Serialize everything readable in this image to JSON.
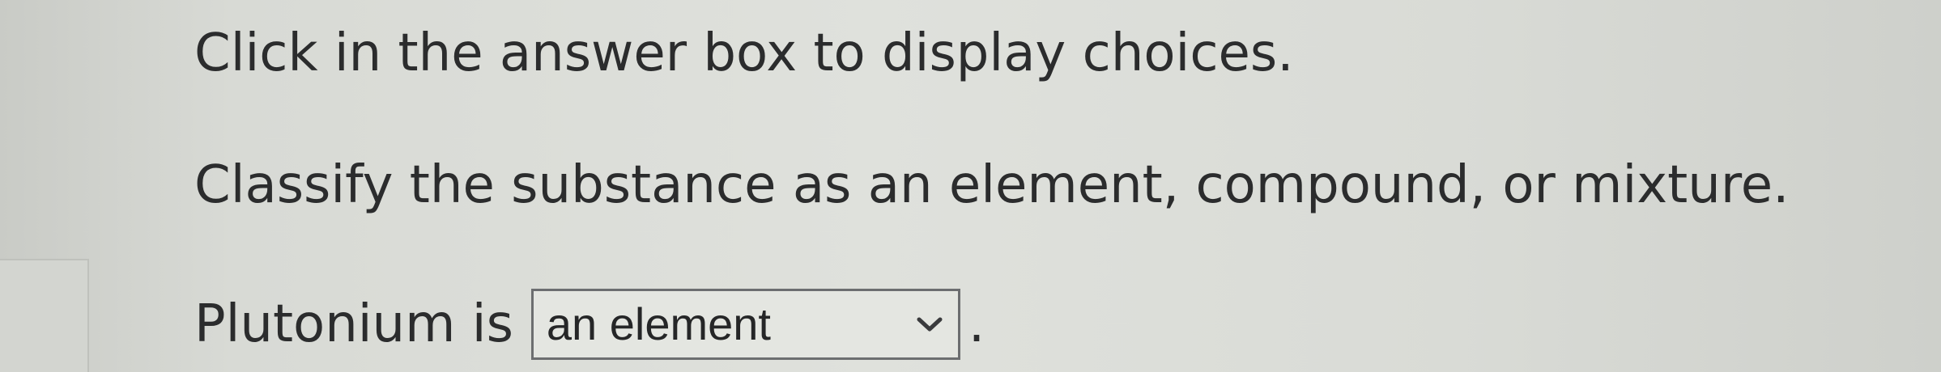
{
  "instruction_text": "Click in the answer box to display choices.",
  "question_text": "Classify the substance as an element, compound, or mixture.",
  "answer": {
    "prompt": "Plutonium is",
    "selected_value": "an element",
    "trailing": "."
  },
  "icons": {
    "dropdown": "chevron-down-icon"
  }
}
